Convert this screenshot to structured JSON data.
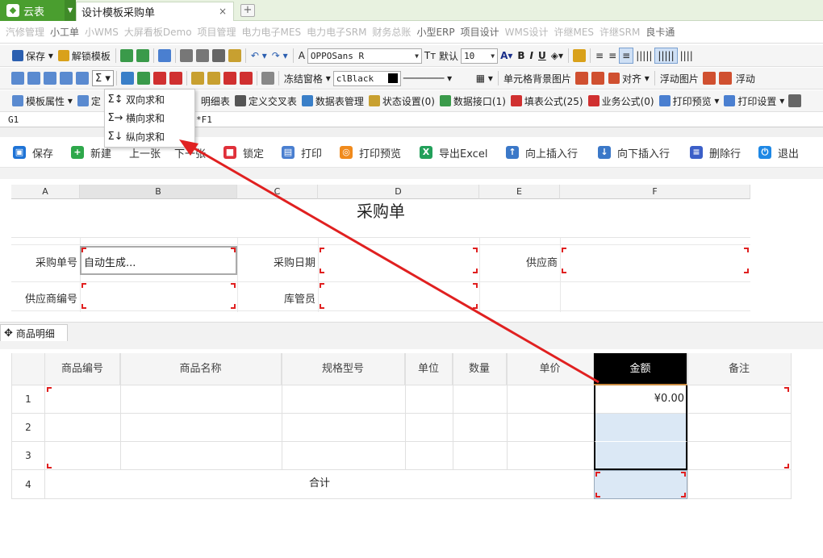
{
  "app": {
    "logo_text": "云表",
    "doc_tab": "设计模板采购单",
    "close": "×",
    "add": "+"
  },
  "navbar": [
    "汽修管理",
    "小工单",
    "小WMS",
    "大屏看板Demo",
    "项目管理",
    "电力电子MES",
    "电力电子SRM",
    "财务总账",
    "小型ERP",
    "项目设计",
    "WMS设计",
    "许继MES",
    "许继SRM",
    "良卡通"
  ],
  "tb1": {
    "save": "保存",
    "unlock": "解锁模板",
    "font": "OPPOSans R",
    "default": "默认",
    "size": "10",
    "bold": "B",
    "italic": "I",
    "underline": "U"
  },
  "tb2": {
    "sigma": "Σ",
    "freeze": "冻结窗格",
    "color": "clBlack",
    "cell_bg": "单元格背景图片",
    "align": "对齐",
    "float_img": "浮动图片",
    "float2": "浮动"
  },
  "tb3": {
    "tpl_attr": "模板属性",
    "def": "定",
    "detail": "明细表",
    "cross": "定义交叉表",
    "ds": "数据表管理",
    "status": "状态设置(0)",
    "api": "数据接口(1)",
    "fill": "填表公式(25)",
    "biz": "业务公式(0)",
    "preview": "打印预览",
    "print_set": "打印设置"
  },
  "formula_bar": {
    "cell": "G1",
    "formula": "*F1"
  },
  "menu": [
    {
      "icon": "Σ↕",
      "label": "双向求和"
    },
    {
      "icon": "Σ→",
      "label": "横向求和"
    },
    {
      "icon": "Σ↓",
      "label": "纵向求和"
    }
  ],
  "actions": [
    {
      "label": "保存",
      "color": "#1e73d6"
    },
    {
      "label": "新建",
      "color": "#2ea84b"
    },
    {
      "label": "上一张",
      "color": "#999999"
    },
    {
      "label": "下一张",
      "color": "#999999"
    },
    {
      "label": "锁定",
      "color": "#e0303a"
    },
    {
      "label": "打印",
      "color": "#4a7fd0"
    },
    {
      "label": "打印预览",
      "color": "#f08a1c"
    },
    {
      "label": "导出Excel",
      "color": "#22a05a"
    },
    {
      "label": "向上插入行",
      "color": "#3b78c8"
    },
    {
      "label": "向下插入行",
      "color": "#3b78c8"
    },
    {
      "label": "删除行",
      "color": "#3b5fc8"
    },
    {
      "label": "退出",
      "color": "#1e88e5"
    }
  ],
  "sheet": {
    "cols": [
      "A",
      "B",
      "C",
      "D",
      "E",
      "F"
    ],
    "title": "采购单",
    "po_no_label": "采购单号",
    "po_no_value": "自动生成...",
    "po_date_label": "采购日期",
    "supplier_label": "供应商",
    "supplier_no_label": "供应商编号",
    "keeper_label": "库管员"
  },
  "detail_tab": "商品明细",
  "detail": {
    "headers": [
      "商品编号",
      "商品名称",
      "规格型号",
      "单位",
      "数量",
      "单价",
      "金额",
      "备注"
    ],
    "rows": [
      "1",
      "2",
      "3",
      "4"
    ],
    "amount_row1": "¥0.00",
    "total_label": "合计"
  },
  "colors": {
    "accent": "#4a9e2f",
    "selected_col": "#000000",
    "highlight": "#dbe8f5",
    "arrow": "#e02020"
  }
}
